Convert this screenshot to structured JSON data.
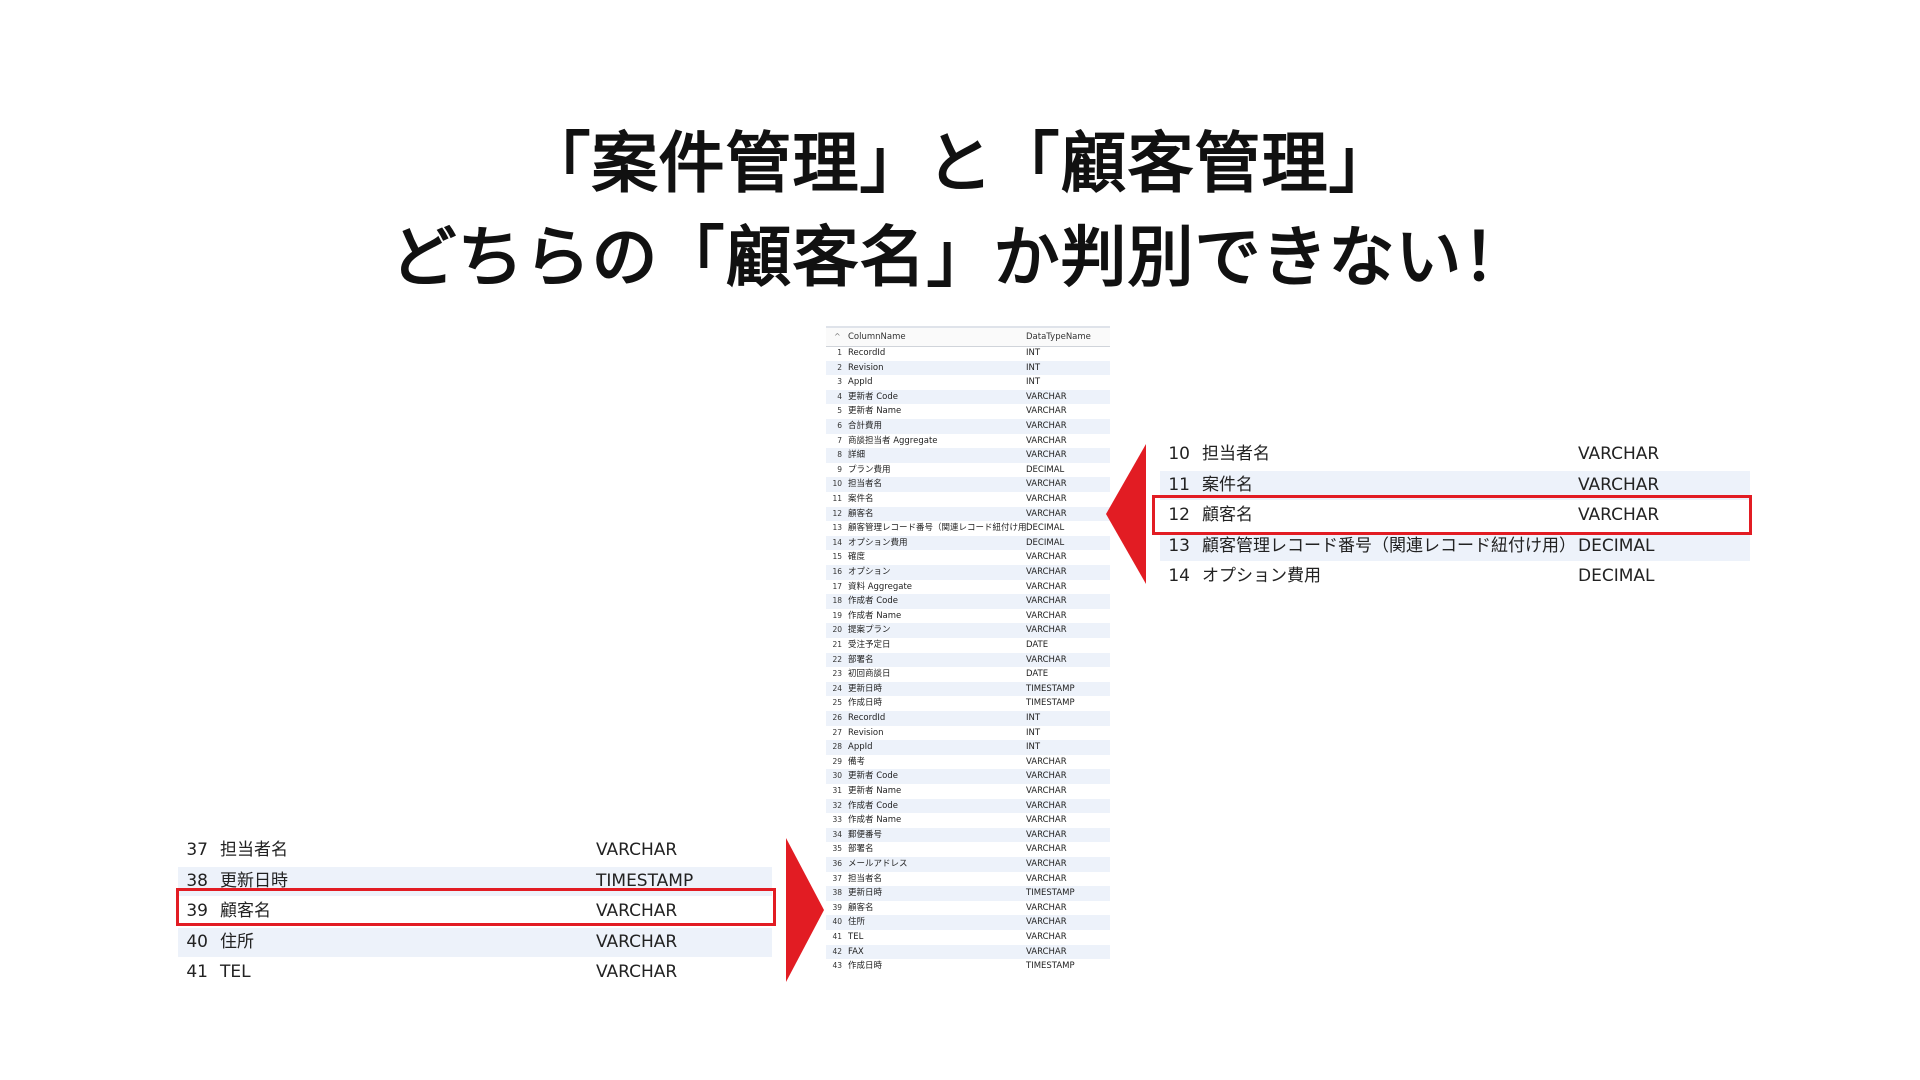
{
  "headline": {
    "line1": "「案件管理」と「顧客管理」",
    "line2": "どちらの「顧客名」か判別できない！"
  },
  "main_table": {
    "header": {
      "sort_icon": "^",
      "column_name": "ColumnName",
      "data_type_name": "DataTypeName"
    },
    "rows": [
      {
        "no": "1",
        "column": "RecordId",
        "type": "INT"
      },
      {
        "no": "2",
        "column": "Revision",
        "type": "INT"
      },
      {
        "no": "3",
        "column": "AppId",
        "type": "INT"
      },
      {
        "no": "4",
        "column": "更新者 Code",
        "type": "VARCHAR"
      },
      {
        "no": "5",
        "column": "更新者 Name",
        "type": "VARCHAR"
      },
      {
        "no": "6",
        "column": "合計費用",
        "type": "VARCHAR"
      },
      {
        "no": "7",
        "column": "商談担当者 Aggregate",
        "type": "VARCHAR"
      },
      {
        "no": "8",
        "column": "詳細",
        "type": "VARCHAR"
      },
      {
        "no": "9",
        "column": "プラン費用",
        "type": "DECIMAL"
      },
      {
        "no": "10",
        "column": "担当者名",
        "type": "VARCHAR"
      },
      {
        "no": "11",
        "column": "案件名",
        "type": "VARCHAR"
      },
      {
        "no": "12",
        "column": "顧客名",
        "type": "VARCHAR"
      },
      {
        "no": "13",
        "column": "顧客管理レコード番号（関連レコード紐付け用）",
        "type": "DECIMAL"
      },
      {
        "no": "14",
        "column": "オプション費用",
        "type": "DECIMAL"
      },
      {
        "no": "15",
        "column": "確度",
        "type": "VARCHAR"
      },
      {
        "no": "16",
        "column": "オプション",
        "type": "VARCHAR"
      },
      {
        "no": "17",
        "column": "資料 Aggregate",
        "type": "VARCHAR"
      },
      {
        "no": "18",
        "column": "作成者 Code",
        "type": "VARCHAR"
      },
      {
        "no": "19",
        "column": "作成者 Name",
        "type": "VARCHAR"
      },
      {
        "no": "20",
        "column": "提案プラン",
        "type": "VARCHAR"
      },
      {
        "no": "21",
        "column": "受注予定日",
        "type": "DATE"
      },
      {
        "no": "22",
        "column": "部署名",
        "type": "VARCHAR"
      },
      {
        "no": "23",
        "column": "初回商談日",
        "type": "DATE"
      },
      {
        "no": "24",
        "column": "更新日時",
        "type": "TIMESTAMP"
      },
      {
        "no": "25",
        "column": "作成日時",
        "type": "TIMESTAMP"
      },
      {
        "no": "26",
        "column": "RecordId",
        "type": "INT"
      },
      {
        "no": "27",
        "column": "Revision",
        "type": "INT"
      },
      {
        "no": "28",
        "column": "AppId",
        "type": "INT"
      },
      {
        "no": "29",
        "column": "備考",
        "type": "VARCHAR"
      },
      {
        "no": "30",
        "column": "更新者 Code",
        "type": "VARCHAR"
      },
      {
        "no": "31",
        "column": "更新者 Name",
        "type": "VARCHAR"
      },
      {
        "no": "32",
        "column": "作成者 Code",
        "type": "VARCHAR"
      },
      {
        "no": "33",
        "column": "作成者 Name",
        "type": "VARCHAR"
      },
      {
        "no": "34",
        "column": "郵便番号",
        "type": "VARCHAR"
      },
      {
        "no": "35",
        "column": "部署名",
        "type": "VARCHAR"
      },
      {
        "no": "36",
        "column": "メールアドレス",
        "type": "VARCHAR"
      },
      {
        "no": "37",
        "column": "担当者名",
        "type": "VARCHAR"
      },
      {
        "no": "38",
        "column": "更新日時",
        "type": "TIMESTAMP"
      },
      {
        "no": "39",
        "column": "顧客名",
        "type": "VARCHAR"
      },
      {
        "no": "40",
        "column": "住所",
        "type": "VARCHAR"
      },
      {
        "no": "41",
        "column": "TEL",
        "type": "VARCHAR"
      },
      {
        "no": "42",
        "column": "FAX",
        "type": "VARCHAR"
      },
      {
        "no": "43",
        "column": "作成日時",
        "type": "TIMESTAMP"
      }
    ]
  },
  "zoom_left": {
    "rows": [
      {
        "no": "37",
        "column": "担当者名",
        "type": "VARCHAR"
      },
      {
        "no": "38",
        "column": "更新日時",
        "type": "TIMESTAMP"
      },
      {
        "no": "39",
        "column": "顧客名",
        "type": "VARCHAR"
      },
      {
        "no": "40",
        "column": "住所",
        "type": "VARCHAR"
      },
      {
        "no": "41",
        "column": "TEL",
        "type": "VARCHAR"
      }
    ]
  },
  "zoom_right": {
    "rows": [
      {
        "no": "10",
        "column": "担当者名",
        "type": "VARCHAR"
      },
      {
        "no": "11",
        "column": "案件名",
        "type": "VARCHAR"
      },
      {
        "no": "12",
        "column": "顧客名",
        "type": "VARCHAR"
      },
      {
        "no": "13",
        "column": "顧客管理レコード番号（関連レコード紐付け用）",
        "type": "DECIMAL"
      },
      {
        "no": "14",
        "column": "オプション費用",
        "type": "DECIMAL"
      }
    ]
  },
  "colors": {
    "highlight": "#e21c23",
    "row_alt": "#edf2fa",
    "text": "#111111"
  }
}
